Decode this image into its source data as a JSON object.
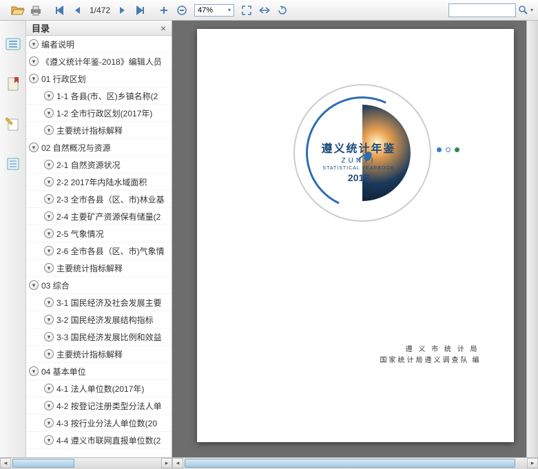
{
  "toolbar": {
    "page_indicator": "1/472",
    "zoom": "47%"
  },
  "toc": {
    "title": "目录",
    "items": [
      {
        "label": "编者说明",
        "indent": 0,
        "glyph": "▾"
      },
      {
        "label": "《遵义统计年鉴-2018》编辑人员",
        "indent": 0,
        "glyph": "▾"
      },
      {
        "label": "01 行政区划",
        "indent": 0,
        "glyph": "▾"
      },
      {
        "label": "1-1 各县(市、区)乡镇名称(2",
        "indent": 1,
        "glyph": "▾"
      },
      {
        "label": "1-2 全市行政区划(2017年)",
        "indent": 1,
        "glyph": "▾"
      },
      {
        "label": "主要统计指标解释",
        "indent": 1,
        "glyph": "▾"
      },
      {
        "label": "02 自然概况与资源",
        "indent": 0,
        "glyph": "▾"
      },
      {
        "label": "2-1 自然资源状况",
        "indent": 1,
        "glyph": "▾"
      },
      {
        "label": "2-2 2017年内陆水域面积",
        "indent": 1,
        "glyph": "▾"
      },
      {
        "label": "2-3 全市各县（区、市)林业基",
        "indent": 1,
        "glyph": "▾"
      },
      {
        "label": "2-4 主要矿产资源保有储量(2",
        "indent": 1,
        "glyph": "▾"
      },
      {
        "label": "2-5 气象情况",
        "indent": 1,
        "glyph": "▾"
      },
      {
        "label": "2-6 全市各县（区、市)气象情",
        "indent": 1,
        "glyph": "▾"
      },
      {
        "label": "主要统计指标解释",
        "indent": 1,
        "glyph": "▾"
      },
      {
        "label": "03 综合",
        "indent": 0,
        "glyph": "▾"
      },
      {
        "label": "3-1 国民经济及社会发展主要",
        "indent": 1,
        "glyph": "▾"
      },
      {
        "label": "3-2 国民经济发展结构指标",
        "indent": 1,
        "glyph": "▾"
      },
      {
        "label": "3-3 国民经济发展比例和效益",
        "indent": 1,
        "glyph": "▾"
      },
      {
        "label": "主要统计指标解释",
        "indent": 1,
        "glyph": "▾"
      },
      {
        "label": "04 基本单位",
        "indent": 0,
        "glyph": "▾"
      },
      {
        "label": "4-1 法人单位数(2017年)",
        "indent": 1,
        "glyph": "▾"
      },
      {
        "label": "4-2 按登记注册类型分法人单",
        "indent": 1,
        "glyph": "▾"
      },
      {
        "label": "4-3 按行业分法人单位数(20",
        "indent": 1,
        "glyph": "▾"
      },
      {
        "label": "4-4 遵义市联网直报单位数(2",
        "indent": 1,
        "glyph": "▾"
      }
    ]
  },
  "page": {
    "title_cn": "遵义统计年鉴",
    "title_en1": "ZUNYI",
    "title_en2": "STATISTICAL YEARBOOK",
    "year": "2018",
    "publisher_line1": "遵 义 市 统 计 局",
    "publisher_line2": "国家统计局遵义调查队",
    "publisher_bian": "编"
  }
}
